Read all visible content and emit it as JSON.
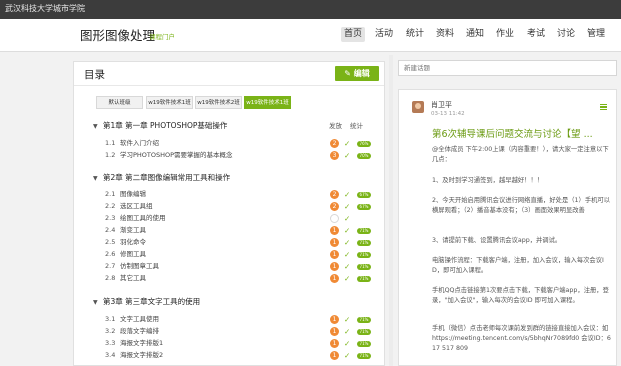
{
  "topbar": {
    "title": "武汉科技大学城市学院"
  },
  "header": {
    "brand": "图形图像处理",
    "brand_sub": "课程门户",
    "nav": [
      "首页",
      "活动",
      "统计",
      "资料",
      "通知",
      "作业",
      "考试",
      "讨论",
      "管理"
    ],
    "active_nav": "首页"
  },
  "catalog": {
    "title": "目录",
    "edit_label": "编辑",
    "tabs": [
      "默认班级",
      "w19软件技术1班",
      "w19软件技术2班",
      "w19软件技术1班"
    ],
    "active_tab": 3,
    "col_publish": "发放",
    "col_stats": "统计",
    "chapters": [
      {
        "title": "第1章 第一章 PHOTOSHOP基础操作",
        "items": [
          {
            "num": "1.1",
            "name": "软件入门介绍",
            "badge": "2",
            "stat": "76%"
          },
          {
            "num": "1.2",
            "name": "学习PHOTOSHOP需要掌握的基本概念",
            "badge": "3",
            "stat": "70%"
          }
        ]
      },
      {
        "title": "第2章 第二章图像编辑常用工具和操作",
        "items": [
          {
            "num": "2.1",
            "name": "图像编辑",
            "badge": "2",
            "stat": "67%"
          },
          {
            "num": "2.2",
            "name": "选区工具组",
            "badge": "2",
            "stat": "67%"
          },
          {
            "num": "2.3",
            "name": "绘图工具的使用",
            "badge": "",
            "stat": ""
          },
          {
            "num": "2.4",
            "name": "渐变工具",
            "badge": "1",
            "stat": "71%"
          },
          {
            "num": "2.5",
            "name": "羽化命令",
            "badge": "1",
            "stat": "71%"
          },
          {
            "num": "2.6",
            "name": "修图工具",
            "badge": "1",
            "stat": "71%"
          },
          {
            "num": "2.7",
            "name": "仿制图章工具",
            "badge": "1",
            "stat": "71%"
          },
          {
            "num": "2.8",
            "name": "其它工具",
            "badge": "1",
            "stat": "71%"
          }
        ]
      },
      {
        "title": "第3章 第三章文字工具的使用",
        "items": [
          {
            "num": "3.1",
            "name": "文字工具使用",
            "badge": "1",
            "stat": "71%"
          },
          {
            "num": "3.2",
            "name": "段落文字编排",
            "badge": "1",
            "stat": "71%"
          },
          {
            "num": "3.3",
            "name": "海报文字排版1",
            "badge": "1",
            "stat": "71%"
          },
          {
            "num": "3.4",
            "name": "海报文字排版2",
            "badge": "1",
            "stat": "71%"
          }
        ]
      }
    ]
  },
  "topic": {
    "search_placeholder": "新建话题",
    "author": "肖卫平",
    "time": "03-13 11:42",
    "title": "第6次辅导课后问题交流与讨论【望 ...",
    "paragraphs": [
      "@全体成员 下午2:00上课（内容重要！），请大家一定注意以下几点：",
      "1、及时到学习通签到，越早越好！！！",
      "2、今天开始启用腾讯会议进行网络直播，好处是（1）手机可以横屏观看；（2）播音基本没有；（3）画面效果明显改善",
      "3、请提前下载、设置腾讯会议app，并调试。",
      "电脑操作流程：下载客户端，注册，加入会议，输入每次会议ID，即可加入课程。",
      "手机QQ点击链接第1次要点击下载，下载客户端app，注册，登录，\"加入会议\"，输入每次的会议ID 即可加入课程。",
      "手机（微信）点击老师每次课前发到群的链接直接加入会议：如 https://meeting.tencent.com/s/5bhqNr7089fd0 会议ID：617 517 809"
    ]
  },
  "colors": {
    "accent": "#7ab317",
    "badge": "#f08a35",
    "topbar": "#3c3c3c"
  }
}
